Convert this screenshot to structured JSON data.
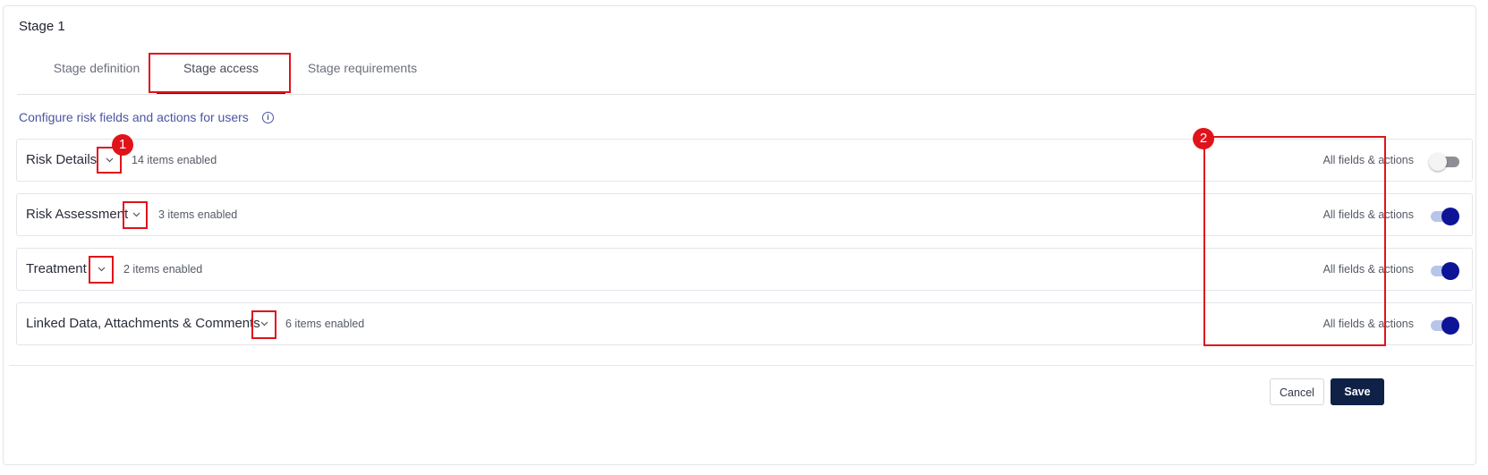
{
  "stage_title": "Stage 1",
  "tabs": [
    {
      "label": "Stage definition",
      "active": false
    },
    {
      "label": "Stage access",
      "active": true
    },
    {
      "label": "Stage requirements",
      "active": false
    }
  ],
  "config_link": "Configure risk fields and actions for users",
  "info_icon": "i",
  "sections": [
    {
      "title": "Risk Details",
      "count": "14 items enabled",
      "all_label": "All fields & actions",
      "enabled": false
    },
    {
      "title": "Risk Assessment",
      "count": "3 items enabled",
      "all_label": "All fields & actions",
      "enabled": true
    },
    {
      "title": "Treatment",
      "count": "2 items enabled",
      "all_label": "All fields & actions",
      "enabled": true
    },
    {
      "title": "Linked Data, Attachments & Comments",
      "count": "6 items enabled",
      "all_label": "All fields & actions",
      "enabled": true
    }
  ],
  "annotations": {
    "badge_1": "1",
    "badge_2": "2"
  },
  "buttons": {
    "cancel": "Cancel",
    "save": "Save"
  },
  "colors": {
    "accent": "#0e1496",
    "annotation": "#e0131a",
    "save_bg": "#0f2147",
    "link": "#4a55a2"
  }
}
